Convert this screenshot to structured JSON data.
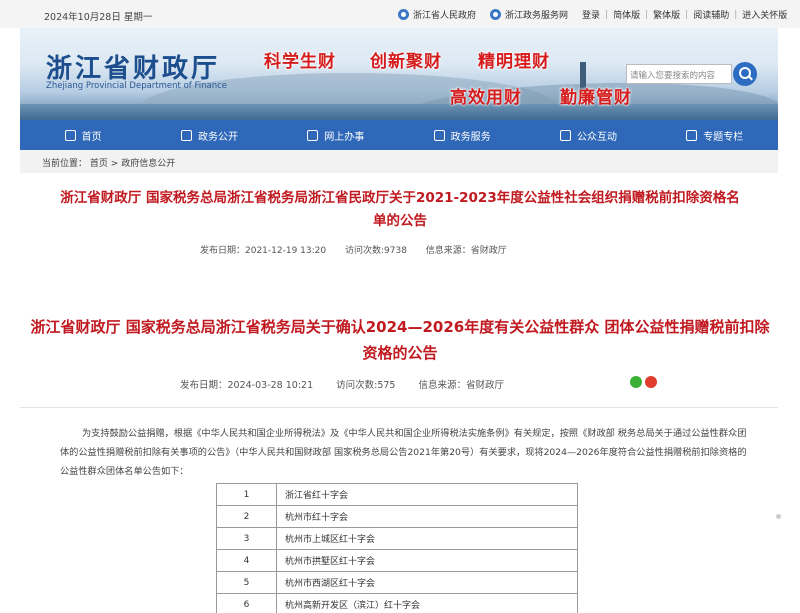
{
  "topbar": {
    "date": "2024年10月28日 星期一",
    "link_province": "浙江省人民政府",
    "link_service": "浙江政务服务网",
    "login": "登录",
    "simplified": "简体版",
    "traditional": "繁体版",
    "accessibility": "阅读辅助",
    "elderly": "进入关怀版"
  },
  "header": {
    "logo": "浙江省财政厅",
    "logo_en": "Zhejiang Provincial Department of Finance",
    "slogans": [
      "科学生财",
      "创新聚财",
      "精明理财",
      "高效用财",
      "勤廉管财"
    ],
    "search_placeholder": "请输入您要搜索的内容"
  },
  "nav": {
    "items": [
      {
        "label": "首页",
        "icon": "home-icon"
      },
      {
        "label": "政务公开",
        "icon": "folder-icon"
      },
      {
        "label": "网上办事",
        "icon": "heart-icon"
      },
      {
        "label": "政务服务",
        "icon": "monitor-icon"
      },
      {
        "label": "公众互动",
        "icon": "people-icon"
      },
      {
        "label": "专题专栏",
        "icon": "doc-icon"
      }
    ]
  },
  "breadcrumb": {
    "label": "当前位置：",
    "home": "首页",
    "sep": ">",
    "current": "政府信息公开"
  },
  "article1": {
    "title": "浙江省财政厅 国家税务总局浙江省税务局浙江省民政厅关于2021-2023年度公益性社会组织捐赠税前扣除资格名单的公告",
    "date": "发布日期：2021-12-19 13:20",
    "visits": "访问次数:9738",
    "source": "信息来源：省财政厅"
  },
  "article2": {
    "title": "浙江省财政厅 国家税务总局浙江省税务局关于确认2024—2026年度有关公益性群众 团体公益性捐赠税前扣除资格的公告",
    "date": "发布日期：2024-03-28 10:21",
    "visits": "访问次数:575",
    "source": "信息来源：省财政厅",
    "paragraph": "为支持鼓励公益捐赠，根据《中华人民共和国企业所得税法》及《中华人民共和国企业所得税法实施条例》有关规定，按照《财政部 税务总局关于通过公益性群众团体的公益性捐赠税前扣除有关事项的公告》（中华人民共和国财政部 国家税务总局公告2021年第20号）有关要求，现将2024—2026年度符合公益性捐赠税前扣除资格的公益性群众团体名单公告如下：",
    "rows": [
      {
        "no": "1",
        "name": "浙江省红十字会"
      },
      {
        "no": "2",
        "name": "杭州市红十字会"
      },
      {
        "no": "3",
        "name": "杭州市上城区红十字会"
      },
      {
        "no": "4",
        "name": "杭州市拱墅区红十字会"
      },
      {
        "no": "5",
        "name": "杭州市西湖区红十字会"
      },
      {
        "no": "6",
        "name": "杭州高新开发区（滨江）红十字会"
      }
    ]
  }
}
